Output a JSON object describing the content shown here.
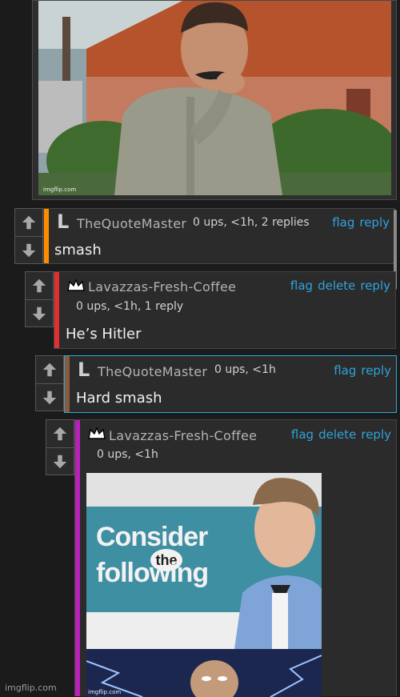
{
  "top_image": {
    "alt": "animated character thinking",
    "watermark": "imgflip.com"
  },
  "comments": [
    {
      "username": "TheQuoteMaster",
      "meta": "0 ups, <1h, 2 replies",
      "actions": [
        "flag",
        "reply"
      ],
      "text": "smash",
      "stripe": "#ff8c00"
    },
    {
      "username": "Lavazzas-Fresh-Coffee",
      "meta": "0 ups, <1h, 1 reply",
      "actions": [
        "flag",
        "delete",
        "reply"
      ],
      "text": "He’s Hitler",
      "stripe": "#e03131"
    },
    {
      "username": "TheQuoteMaster",
      "meta": "0 ups, <1h",
      "actions": [
        "flag",
        "reply"
      ],
      "text": "Hard smash",
      "stripe": "#8a5a3c"
    },
    {
      "username": "Lavazzas-Fresh-Coffee",
      "meta": "0 ups, <1h",
      "actions": [
        "flag",
        "delete",
        "reply"
      ],
      "text": "",
      "stripe": "#b91fb9"
    }
  ],
  "meme": {
    "line1": "Consider",
    "line2": "the",
    "line3": "following",
    "watermark": "imgflip.com"
  },
  "footer": {
    "site": "imgflip.com"
  },
  "colors": {
    "accent": "#2fa3dc",
    "highlight_border": "#26a9e0"
  }
}
